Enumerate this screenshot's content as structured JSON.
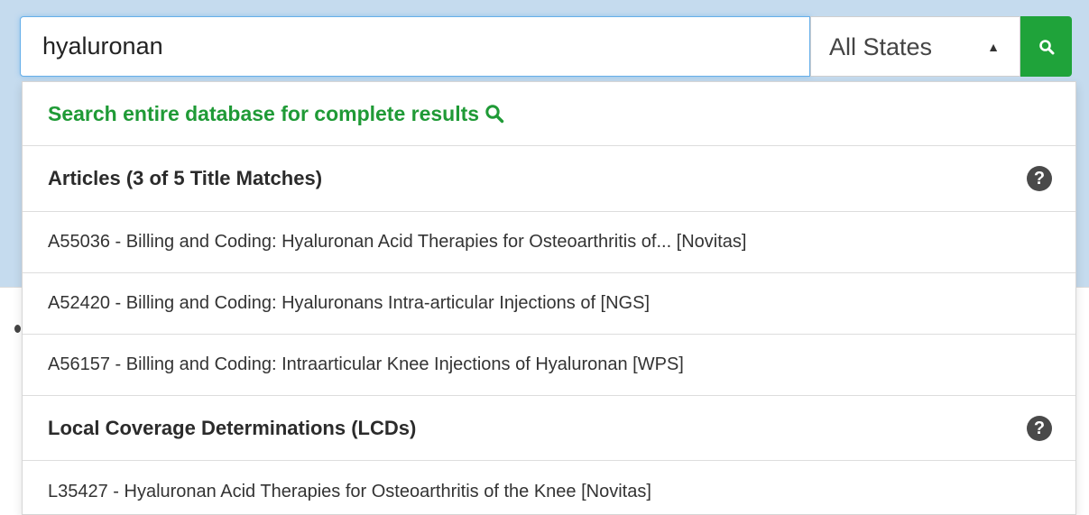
{
  "search": {
    "query": "hyaluronan",
    "state_selected": "All States"
  },
  "dropdown": {
    "search_all_label": "Search entire database for complete results",
    "sections": [
      {
        "title": "Articles (3 of 5 Title Matches)",
        "items": [
          "A55036 - Billing and Coding: Hyaluronan Acid Therapies for Osteoarthritis of... [Novitas]",
          "A52420 - Billing and Coding: Hyaluronans Intra-articular Injections of [NGS]",
          "A56157 - Billing and Coding: Intraarticular Knee Injections of Hyaluronan [WPS]"
        ]
      },
      {
        "title": "Local Coverage Determinations (LCDs)",
        "items": [
          "L35427 - Hyaluronan Acid Therapies for Osteoarthritis of the Knee [Novitas]"
        ]
      }
    ]
  },
  "icons": {
    "help": "?",
    "search": "search-icon",
    "caret": "up-down-caret"
  },
  "colors": {
    "accent_green": "#1fa33a",
    "link_green": "#1f9a36",
    "focus_blue": "#66afe9"
  }
}
